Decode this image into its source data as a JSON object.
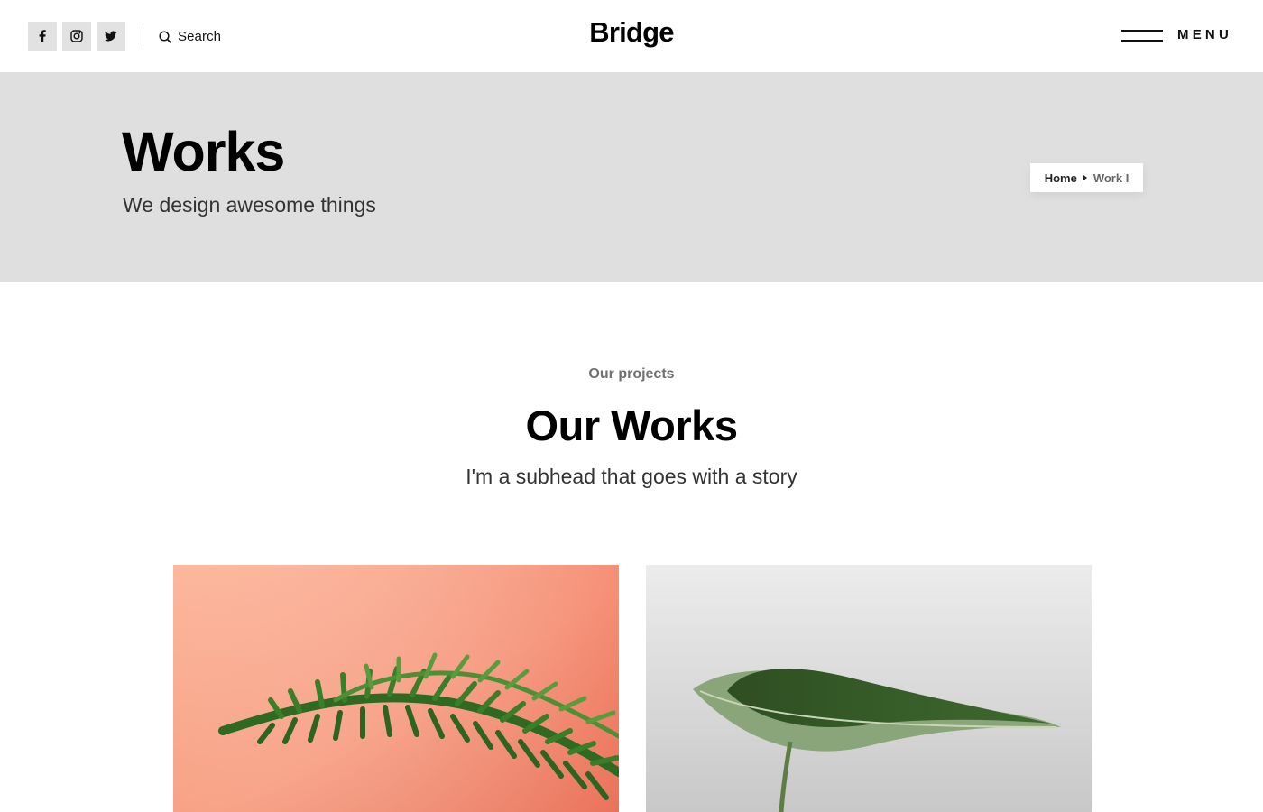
{
  "header": {
    "logo": "Bridge",
    "search_label": "Search",
    "menu_label": "MENU",
    "social": [
      {
        "icon": "facebook-icon"
      },
      {
        "icon": "instagram-icon"
      },
      {
        "icon": "twitter-icon"
      }
    ]
  },
  "title_band": {
    "title": "Works",
    "subtitle": "We design awesome things",
    "breadcrumb": {
      "home": "Home",
      "current": "Work I"
    }
  },
  "projects": {
    "kicker": "Our projects",
    "title": "Our Works",
    "subtitle": "I'm a subhead that goes with a story",
    "items": [
      {
        "image": "pine-branch-on-coral-wall"
      },
      {
        "image": "green-leaf-on-grey"
      }
    ]
  },
  "colors": {
    "title_band_bg": "#dfdfdf",
    "social_btn_bg": "#e2e2e2",
    "coral": "#f4957a",
    "leaf_green": "#3f6b2f"
  }
}
